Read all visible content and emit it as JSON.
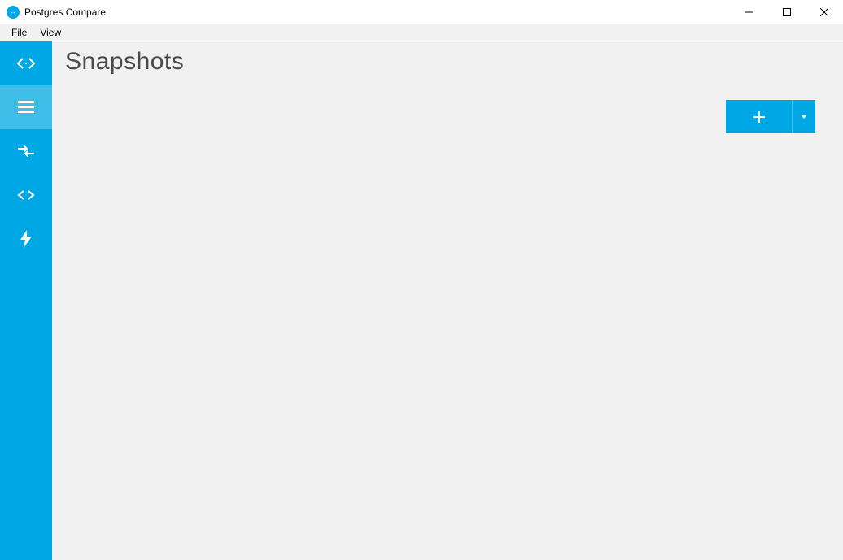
{
  "window": {
    "title": "Postgres Compare",
    "icon": "postgres-compare-icon"
  },
  "menubar": {
    "items": [
      {
        "label": "File",
        "name": "menu-file"
      },
      {
        "label": "View",
        "name": "menu-view"
      }
    ]
  },
  "sidebar": {
    "items": [
      {
        "name": "sidebar-item-comparisons",
        "icon": "compare-arrows-icon",
        "active": false
      },
      {
        "name": "sidebar-item-snapshots",
        "icon": "list-lines-icon",
        "active": true
      },
      {
        "name": "sidebar-item-merge",
        "icon": "merge-arrows-icon",
        "active": false
      },
      {
        "name": "sidebar-item-diff",
        "icon": "code-brackets-icon",
        "active": false
      },
      {
        "name": "sidebar-item-deploy",
        "icon": "lightning-bolt-icon",
        "active": false
      }
    ]
  },
  "main": {
    "title": "Snapshots",
    "add_button": {
      "name": "add-snapshot-button",
      "icon": "plus-icon",
      "dropdown_icon": "caret-down-icon"
    }
  },
  "colors": {
    "brand": "#00a7e5",
    "brand_light": "#3fbeea",
    "panel_bg": "#f1f1f1"
  }
}
